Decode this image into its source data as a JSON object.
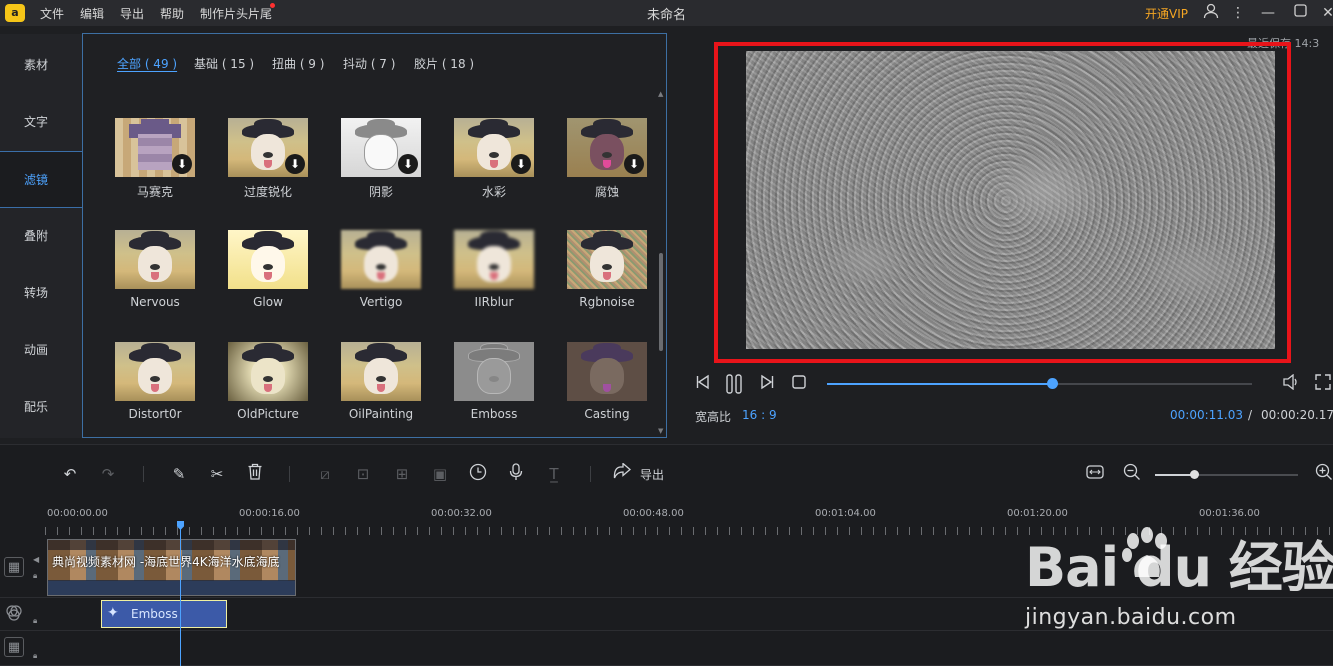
{
  "titlebar": {
    "logo": "a",
    "menu": [
      "文件",
      "编辑",
      "导出",
      "帮助",
      "制作片头片尾"
    ],
    "title": "未命名",
    "vip": "开通VIP"
  },
  "leftnav": {
    "items": [
      "素材",
      "文字",
      "滤镜",
      "叠附",
      "转场",
      "动画",
      "配乐"
    ],
    "active_index": 2
  },
  "filters": {
    "tabs": [
      "全部 ( 49 )",
      "基础 ( 15 )",
      "扭曲 ( 9 )",
      "抖动 ( 7 )",
      "胶片 ( 18 )"
    ],
    "active_tab": 0,
    "items": [
      {
        "label": "马赛克",
        "download": true
      },
      {
        "label": "过度锐化",
        "download": true
      },
      {
        "label": "阴影",
        "download": true
      },
      {
        "label": "水彩",
        "download": true
      },
      {
        "label": "腐蚀",
        "download": true
      },
      {
        "label": "Nervous",
        "download": false
      },
      {
        "label": "Glow",
        "download": false
      },
      {
        "label": "Vertigo",
        "download": false
      },
      {
        "label": "IIRblur",
        "download": false
      },
      {
        "label": "Rgbnoise",
        "download": false
      },
      {
        "label": "Distort0r",
        "download": false
      },
      {
        "label": "OldPicture",
        "download": false
      },
      {
        "label": "OilPainting",
        "download": false
      },
      {
        "label": "Emboss",
        "download": false
      },
      {
        "label": "Casting",
        "download": false
      }
    ]
  },
  "preview": {
    "save_info": "最近保存 14:3",
    "aspect_label": "宽高比",
    "aspect_value": "16 : 9",
    "time_current": "00:00:11.03",
    "time_separator": "/",
    "time_total": "00:00:20.17",
    "progress": 0.53
  },
  "timeline": {
    "export_label": "导出",
    "zoom_level": 0.27,
    "ruler": [
      "00:00:00.00",
      "00:00:16.00",
      "00:00:32.00",
      "00:00:48.00",
      "00:01:04.00",
      "00:01:20.00",
      "00:01:36.00"
    ],
    "video_clip_label": "典尚视频素材网 -海底世界4K海洋水底海底",
    "filter_clip_label": "Emboss"
  },
  "watermark": {
    "brand": "Bai  du 经验",
    "url": "jingyan.baidu.com"
  },
  "colors": {
    "accent": "#4da3ff",
    "vip": "#f5a623",
    "highlight_frame": "#e8141a",
    "filter_clip": "#3c5aa8"
  }
}
